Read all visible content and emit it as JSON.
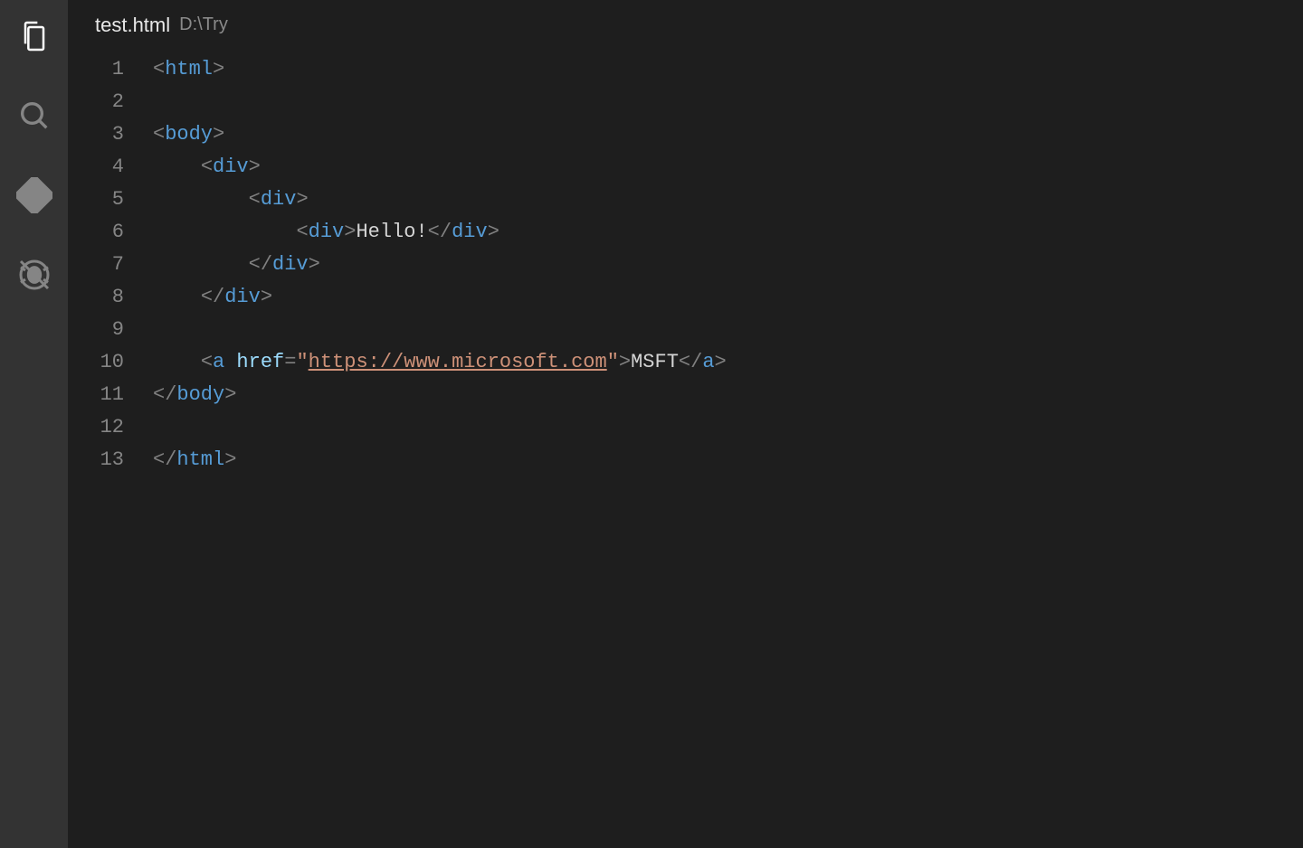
{
  "tab": {
    "filename": "test.html",
    "path": "D:\\Try"
  },
  "activity_icons": [
    {
      "name": "files-icon",
      "active": true
    },
    {
      "name": "search-icon",
      "active": false
    },
    {
      "name": "scm-icon",
      "active": false
    },
    {
      "name": "debug-icon",
      "active": false
    }
  ],
  "line_count": 13,
  "code": {
    "line1": [
      {
        "t": "<",
        "c": "pun"
      },
      {
        "t": "html",
        "c": "tag"
      },
      {
        "t": ">",
        "c": "pun"
      }
    ],
    "line2": [],
    "line3": [
      {
        "t": "<",
        "c": "pun"
      },
      {
        "t": "body",
        "c": "tag"
      },
      {
        "t": ">",
        "c": "pun"
      }
    ],
    "line4": [
      {
        "t": "    ",
        "c": "txt"
      },
      {
        "t": "<",
        "c": "pun"
      },
      {
        "t": "div",
        "c": "tag"
      },
      {
        "t": ">",
        "c": "pun"
      }
    ],
    "line5": [
      {
        "t": "        ",
        "c": "txt"
      },
      {
        "t": "<",
        "c": "pun"
      },
      {
        "t": "div",
        "c": "tag"
      },
      {
        "t": ">",
        "c": "pun"
      }
    ],
    "line6": [
      {
        "t": "            ",
        "c": "txt"
      },
      {
        "t": "<",
        "c": "pun"
      },
      {
        "t": "div",
        "c": "tag"
      },
      {
        "t": ">",
        "c": "pun"
      },
      {
        "t": "Hello!",
        "c": "txt"
      },
      {
        "t": "</",
        "c": "pun"
      },
      {
        "t": "div",
        "c": "tag"
      },
      {
        "t": ">",
        "c": "pun"
      }
    ],
    "line7": [
      {
        "t": "        ",
        "c": "txt"
      },
      {
        "t": "</",
        "c": "pun"
      },
      {
        "t": "div",
        "c": "tag"
      },
      {
        "t": ">",
        "c": "pun"
      }
    ],
    "line8": [
      {
        "t": "    ",
        "c": "txt"
      },
      {
        "t": "</",
        "c": "pun"
      },
      {
        "t": "div",
        "c": "tag"
      },
      {
        "t": ">",
        "c": "pun"
      }
    ],
    "line9": [],
    "line10": [
      {
        "t": "    ",
        "c": "txt"
      },
      {
        "t": "<",
        "c": "pun"
      },
      {
        "t": "a",
        "c": "tag"
      },
      {
        "t": " ",
        "c": "txt"
      },
      {
        "t": "href",
        "c": "attr"
      },
      {
        "t": "=",
        "c": "pun"
      },
      {
        "t": "\"",
        "c": "str"
      },
      {
        "t": "https://www.microsoft.com",
        "c": "url"
      },
      {
        "t": "\"",
        "c": "str"
      },
      {
        "t": ">",
        "c": "pun"
      },
      {
        "t": "MSFT",
        "c": "txt"
      },
      {
        "t": "</",
        "c": "pun"
      },
      {
        "t": "a",
        "c": "tag"
      },
      {
        "t": ">",
        "c": "pun"
      }
    ],
    "line11": [
      {
        "t": "</",
        "c": "pun"
      },
      {
        "t": "body",
        "c": "tag"
      },
      {
        "t": ">",
        "c": "pun"
      }
    ],
    "line12": [],
    "line13": [
      {
        "t": "</",
        "c": "pun"
      },
      {
        "t": "html",
        "c": "tag"
      },
      {
        "t": ">",
        "c": "pun"
      }
    ]
  }
}
